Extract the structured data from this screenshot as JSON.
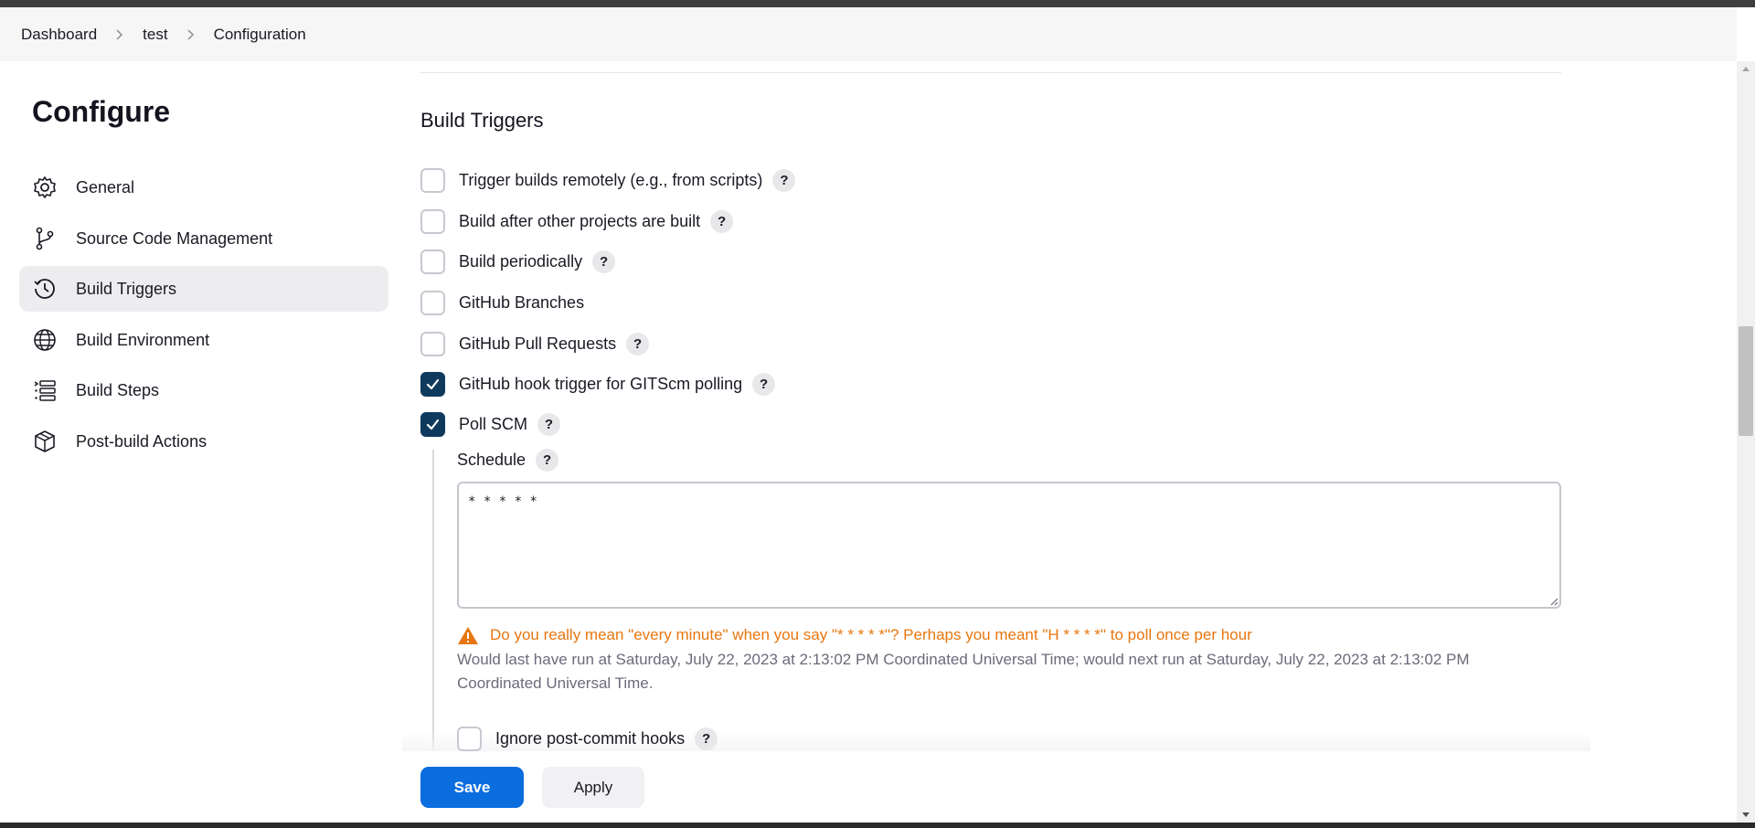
{
  "breadcrumb": {
    "items": [
      "Dashboard",
      "test",
      "Configuration"
    ]
  },
  "sidebar": {
    "title": "Configure",
    "items": [
      {
        "label": "General",
        "icon": "gear-icon"
      },
      {
        "label": "Source Code Management",
        "icon": "branch-icon"
      },
      {
        "label": "Build Triggers",
        "icon": "clock-icon",
        "active": true
      },
      {
        "label": "Build Environment",
        "icon": "globe-icon"
      },
      {
        "label": "Build Steps",
        "icon": "list-icon"
      },
      {
        "label": "Post-build Actions",
        "icon": "package-icon"
      }
    ]
  },
  "main": {
    "section_title": "Build Triggers",
    "triggers": [
      {
        "label": "Trigger builds remotely (e.g., from scripts)",
        "checked": false,
        "help": "?"
      },
      {
        "label": "Build after other projects are built",
        "checked": false,
        "help": "?"
      },
      {
        "label": "Build periodically",
        "checked": false,
        "help": "?"
      },
      {
        "label": "GitHub Branches",
        "checked": false
      },
      {
        "label": "GitHub Pull Requests",
        "checked": false,
        "help": "?"
      },
      {
        "label": "GitHub hook trigger for GITScm polling",
        "checked": true,
        "help": "?"
      },
      {
        "label": "Poll SCM",
        "checked": true,
        "help": "?"
      }
    ],
    "schedule": {
      "label": "Schedule",
      "help": "?",
      "value": "* * * * *"
    },
    "warning": "Do you really mean \"every minute\" when you say \"* * * * *\"? Perhaps you meant \"H * * * *\" to poll once per hour",
    "info": "Would last have run at Saturday, July 22, 2023 at 2:13:02 PM Coordinated Universal Time; would next run at Saturday, July 22, 2023 at 2:13:02 PM Coordinated Universal Time.",
    "ignore_hooks": {
      "label": "Ignore post-commit hooks",
      "checked": false,
      "help": "?"
    }
  },
  "actions": {
    "save_label": "Save",
    "apply_label": "Apply"
  },
  "colors": {
    "accent": "#0b6dde",
    "checked": "#0f3a5e",
    "warning": "#e8760f"
  }
}
